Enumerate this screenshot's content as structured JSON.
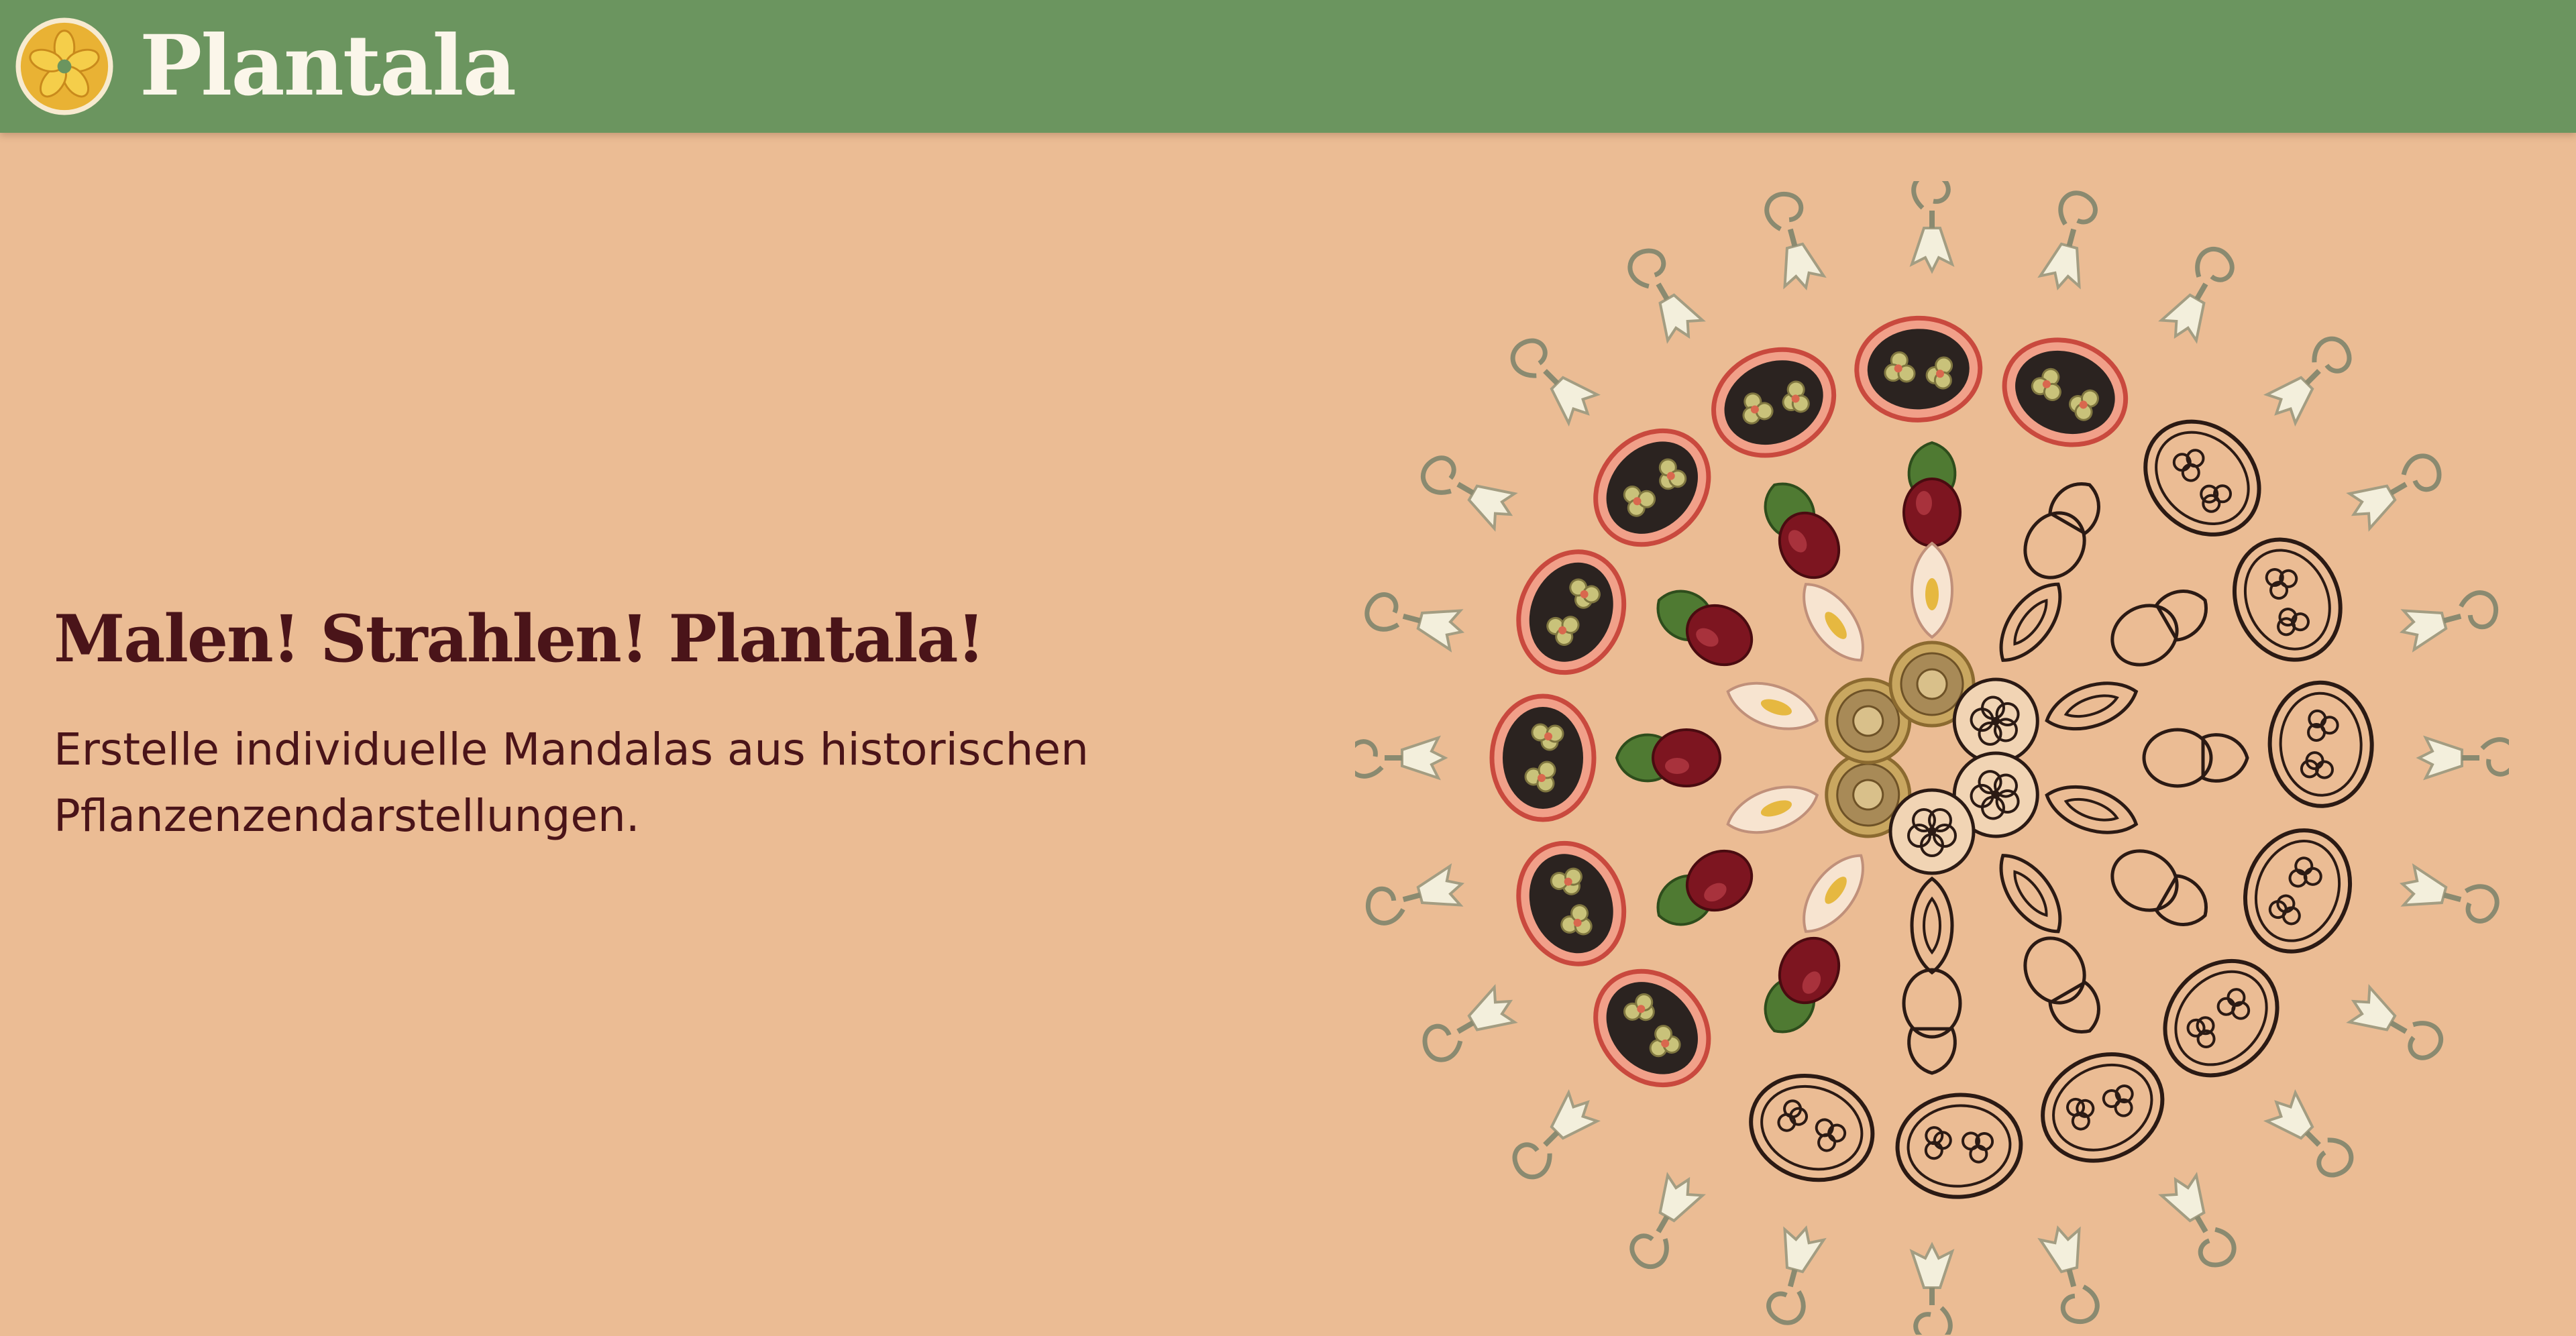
{
  "header": {
    "brand": "Plantala",
    "logo_icon": "flower-icon",
    "colors": {
      "bar": "#6b955f",
      "brand_text": "#fbf6ea"
    }
  },
  "hero": {
    "headline": "Malen! Strahlen! Plantala!",
    "subline_1": "Erstelle individuelle Mandalas aus historischen",
    "subline_2": "Pflanzenzendarstellungen."
  },
  "mandala": {
    "rings": [
      {
        "name": "outer-ring",
        "motif": "sprout-icon",
        "count": 24
      },
      {
        "name": "seed-pod-ring",
        "motif": "seed-pod-icon",
        "count": 16
      },
      {
        "name": "acorn-ring",
        "motif": "acorn-icon",
        "count": 12
      },
      {
        "name": "leaf-ring",
        "motif": "leaf-icon",
        "count": 10
      },
      {
        "name": "core-ring",
        "motif": "cross-section-icon",
        "count": 6
      }
    ]
  },
  "colors": {
    "background": "#ebbc94",
    "text": "#4a1419"
  }
}
